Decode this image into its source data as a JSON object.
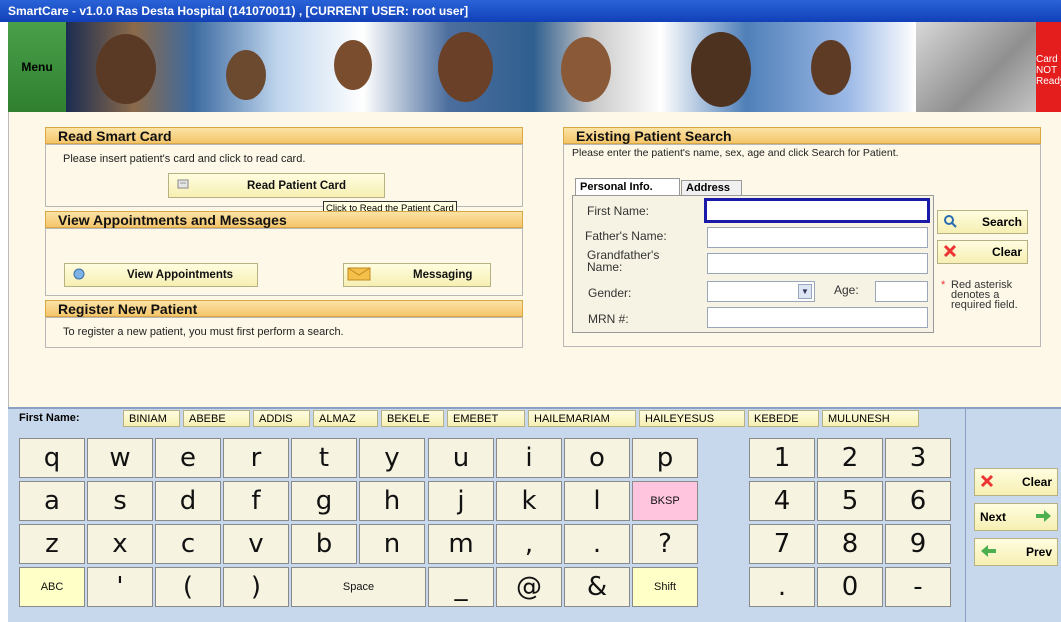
{
  "window": {
    "title": "SmartCare - v1.0.0 Ras Desta Hospital (141070011) , [CURRENT USER: root user]"
  },
  "banner": {
    "menu_label": "Menu",
    "card_status": [
      "Card",
      "NOT",
      "Ready"
    ]
  },
  "read_card": {
    "title": "Read Smart Card",
    "instruction": "Please insert patient's card and click to read card.",
    "button_label": "Read Patient Card",
    "tooltip": "Click to Read the Patient Card"
  },
  "appointments": {
    "title": "View Appointments and Messages",
    "view_label": "View Appointments",
    "messaging_label": "Messaging"
  },
  "register": {
    "title": "Register New Patient",
    "instruction": "To register a new patient, you must first  perform a search."
  },
  "search": {
    "title": "Existing Patient Search",
    "instruction": "Please enter the patient's name, sex, age and click Search for Patient.",
    "tabs": [
      "Personal Info.",
      "Address"
    ],
    "fields": {
      "first_name": {
        "label": "First Name:",
        "value": ""
      },
      "father_name": {
        "label": "Father's Name:",
        "value": ""
      },
      "grandfather_name": {
        "label": "Grandfather's Name:",
        "value": ""
      },
      "gender": {
        "label": "Gender:",
        "value": ""
      },
      "age": {
        "label": "Age:",
        "value": ""
      },
      "mrn": {
        "label": "MRN #:",
        "value": ""
      }
    },
    "search_label": "Search",
    "clear_label": "Clear",
    "required_note": "Red asterisk denotes a required field."
  },
  "keyboard": {
    "first_name_label": "First Name:",
    "name_suggestions": [
      "BINIAM",
      "ABEBE",
      "ADDIS",
      "ALMAZ",
      "BEKELE",
      "EMEBET",
      "HAILEMARIAM",
      "HAILEYESUS",
      "KEBEDE",
      "MULUNESH"
    ],
    "rows": [
      [
        "q",
        "w",
        "e",
        "r",
        "t",
        "y",
        "u",
        "i",
        "o",
        "p"
      ],
      [
        "a",
        "s",
        "d",
        "f",
        "g",
        "h",
        "j",
        "k",
        "l",
        "BKSP"
      ],
      [
        "z",
        "x",
        "c",
        "v",
        "b",
        "n",
        "m",
        ",",
        ".",
        "?"
      ],
      [
        "ABC",
        "'",
        "(",
        ")",
        "Space",
        "_",
        "@",
        "&",
        "Shift"
      ]
    ],
    "numpad": [
      [
        "1",
        "2",
        "3"
      ],
      [
        "4",
        "5",
        "6"
      ],
      [
        "7",
        "8",
        "9"
      ],
      [
        ".",
        "0",
        "-"
      ]
    ]
  },
  "nav": {
    "clear": "Clear",
    "next": "Next",
    "prev": "Prev"
  },
  "colors": {
    "titlebar": "#1a4fc8",
    "panel_header": "#f4c56b",
    "card_not_ready": "#e41d1d",
    "keyboard_bg": "#c8d8ec",
    "active_input_border": "#1a1aa8"
  }
}
